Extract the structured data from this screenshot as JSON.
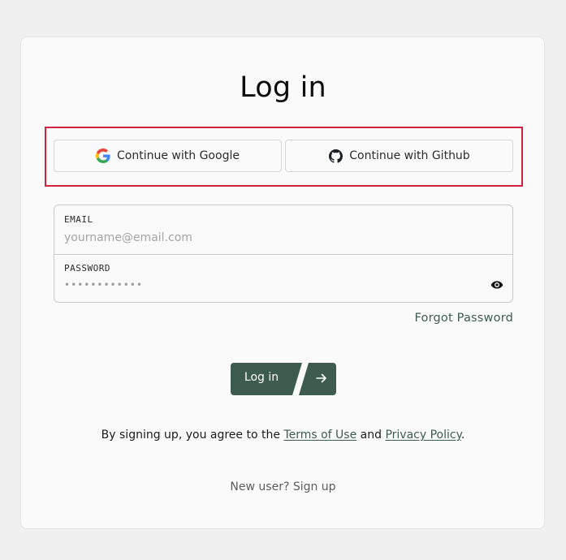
{
  "page": {
    "title": "Log in"
  },
  "oauth": {
    "google_label": "Continue with Google",
    "github_label": "Continue with Github"
  },
  "form": {
    "email_label": "EMAIL",
    "email_placeholder": "yourname@email.com",
    "password_label": "PASSWORD",
    "password_value": "••••••••••••"
  },
  "links": {
    "forgot_password": "Forgot Password",
    "signup": "New user? Sign up"
  },
  "submit": {
    "label": "Log in"
  },
  "terms": {
    "prefix": "By signing up, you agree to the ",
    "terms_link": "Terms of Use",
    "middle": " and ",
    "privacy_link": "Privacy Policy",
    "suffix": "."
  },
  "colors": {
    "accent": "#3d5b4f",
    "highlight": "#d4213d",
    "background": "#eff0ef",
    "card": "#fafafa"
  },
  "icons": {
    "google": "google-icon",
    "github": "github-icon",
    "eye": "eye-icon",
    "arrow": "arrow-right-icon"
  }
}
